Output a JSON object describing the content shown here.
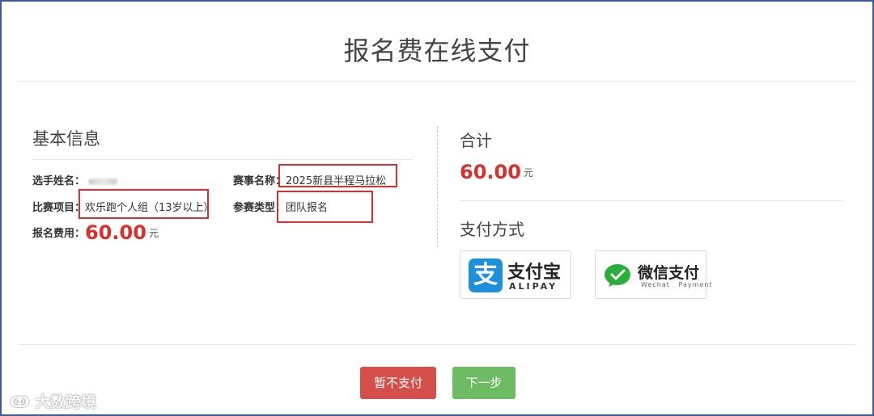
{
  "header": {
    "title": "报名费在线支付"
  },
  "basic_info": {
    "title": "基本信息",
    "fields": {
      "player_name_label": "选手姓名：",
      "event_name_label": "赛事名称：",
      "event_name_value": "2025新县半程马拉松",
      "category_label": "比赛项目：",
      "category_value": "欢乐跑个人组（13岁以上）",
      "entry_type_label": "参赛类型：",
      "entry_type_value": "团队报名",
      "fee_label": "报名费用：",
      "fee_value": "60.00",
      "fee_unit": "元"
    }
  },
  "summary": {
    "total_title": "合计",
    "total_value": "60.00",
    "total_unit": "元",
    "payment_title": "支付方式"
  },
  "payment_methods": {
    "alipay": {
      "icon_glyph": "支",
      "name_cn": "支付宝",
      "name_en": "ALIPAY"
    },
    "wechat": {
      "name_cn": "微信支付",
      "name_en": "Wechat   Payment"
    }
  },
  "actions": {
    "pay_later": "暂不支付",
    "next": "下一步"
  },
  "watermark": "大数跨境",
  "colors": {
    "frame_border": "#3e5c9a",
    "amount_red": "#d9302b",
    "highlight_box": "#d9302b",
    "pay_later_bg": "#d44f49",
    "next_bg": "#6dbb63",
    "alipay_blue": "#1e8fdc",
    "wechat_green": "#2aae3b"
  }
}
